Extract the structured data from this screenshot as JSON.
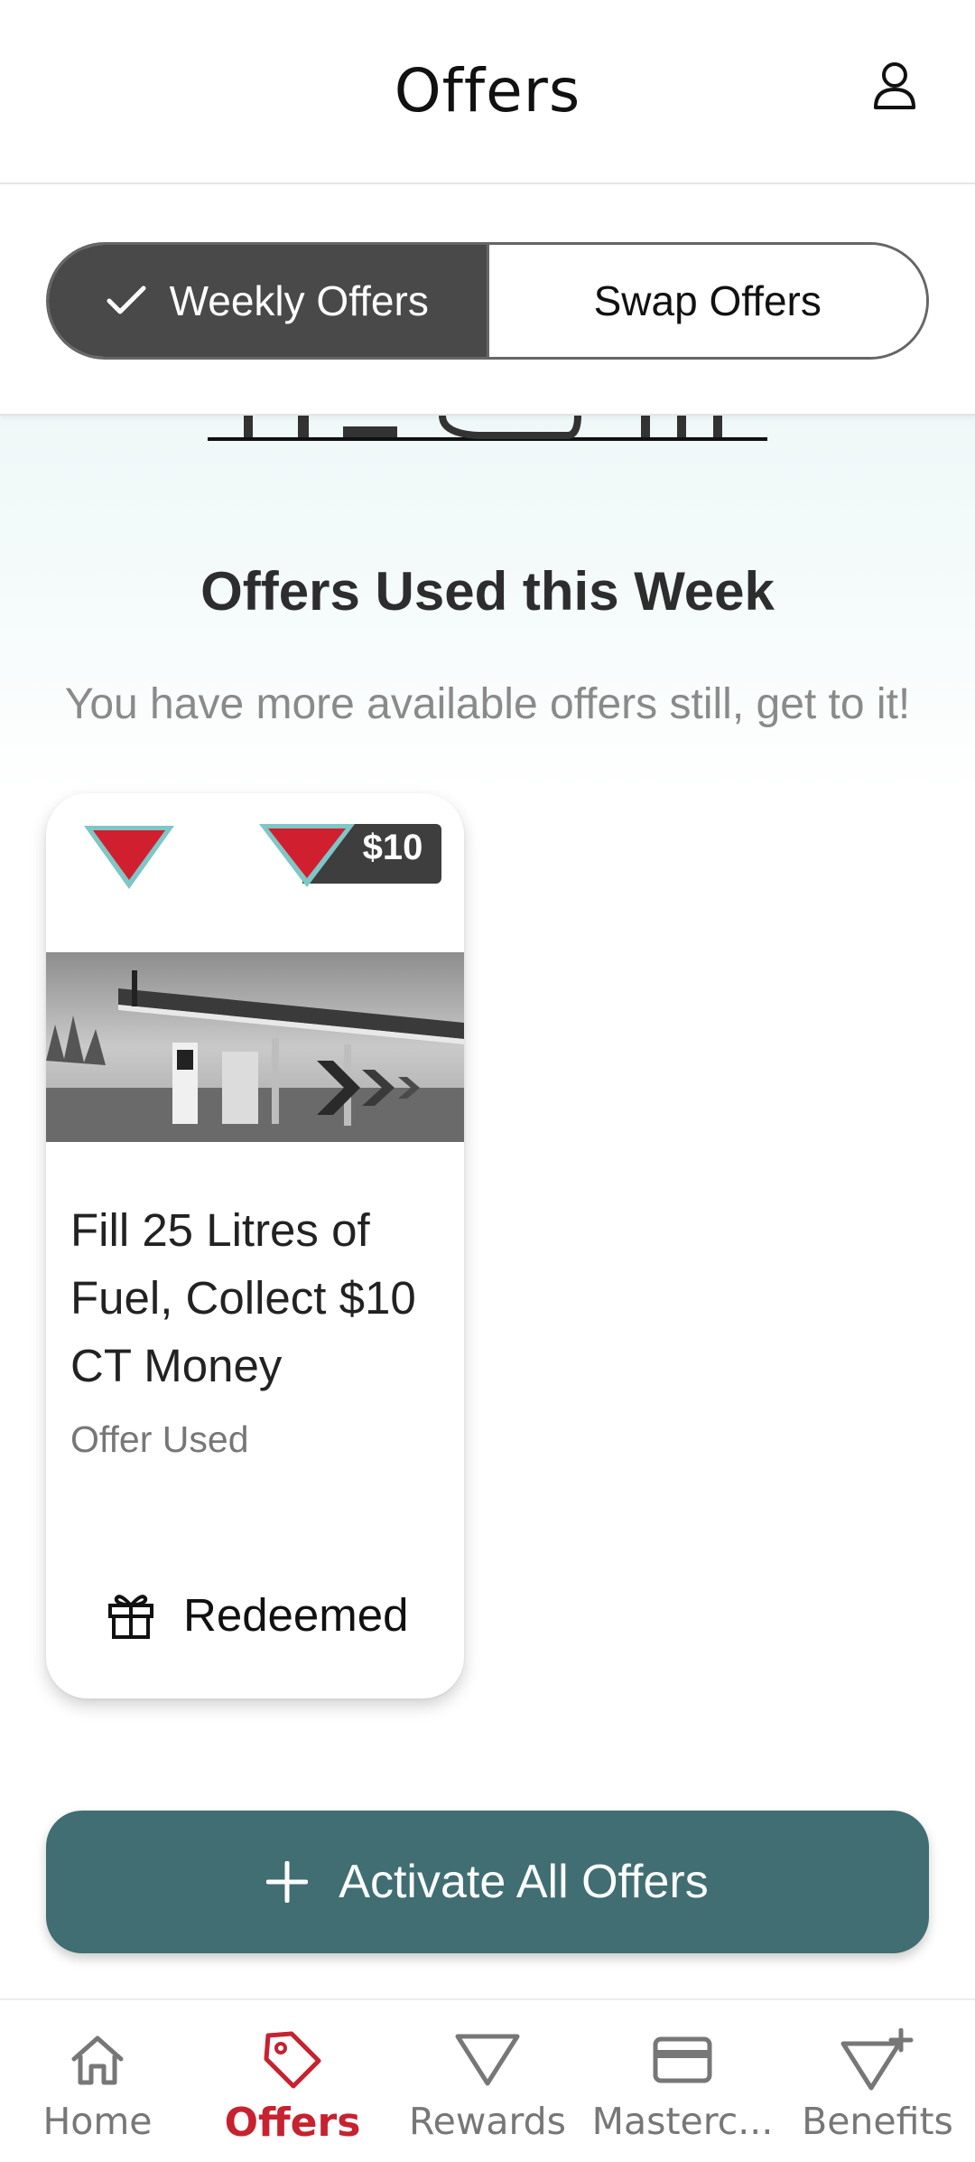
{
  "header": {
    "title": "Offers"
  },
  "toggle": {
    "weekly_label": "Weekly Offers",
    "swap_label": "Swap Offers"
  },
  "section": {
    "title": "Offers Used this Week",
    "subtitle": "You have more available offers still, get to it!"
  },
  "offer_card": {
    "value_badge": "$10",
    "title": "Fill 25 Litres of Fuel, Collect $10 CT Money",
    "status": "Offer Used",
    "action_label": "Redeemed"
  },
  "activate_button": {
    "label": "Activate All Offers"
  },
  "bottom_nav": {
    "items": [
      {
        "label": "Home",
        "icon": "home-icon"
      },
      {
        "label": "Offers",
        "icon": "tag-icon",
        "active": true
      },
      {
        "label": "Rewards",
        "icon": "triangle-icon"
      },
      {
        "label": "Masterc...",
        "icon": "credit-card-icon"
      },
      {
        "label": "Benefits",
        "icon": "triangle-plus-icon"
      }
    ]
  },
  "colors": {
    "accent_red": "#c62230",
    "teal_button": "#406e72",
    "toggle_active": "#494949",
    "brand_red": "#d0202f",
    "brand_teal": "#7fc6c6"
  }
}
